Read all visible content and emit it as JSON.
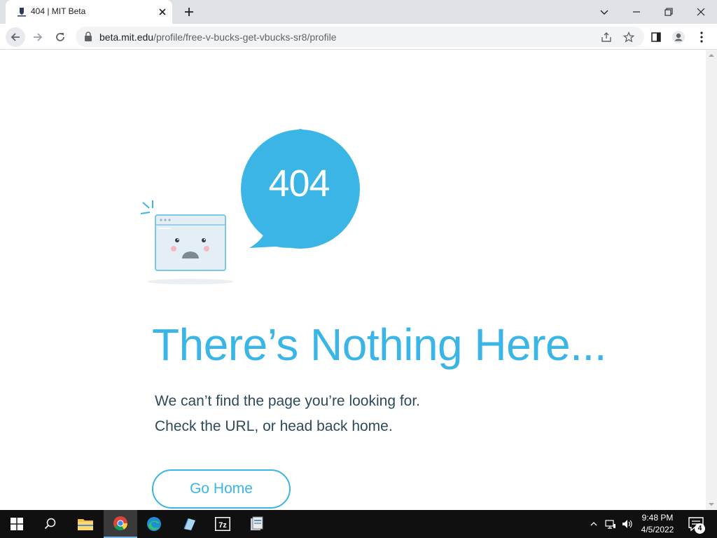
{
  "tab": {
    "title": "404 | MIT Beta",
    "favicon": "mit-shield-icon"
  },
  "toolbar": {
    "url_host": "beta.mit.edu",
    "url_path": "/profile/free-v-bucks-get-vbucks-sr8/profile"
  },
  "page": {
    "code": "404",
    "headline": "There’s Nothing Here...",
    "line1": "We can’t find the page you’re looking for.",
    "line2": "Check the URL, or head back home.",
    "button_label": "Go Home",
    "accent_color": "#3ab5e6"
  },
  "taskbar": {
    "apps": [
      "start",
      "search",
      "file-explorer",
      "chrome",
      "edge",
      "notepad",
      "7zip",
      "app"
    ],
    "time": "9:48 PM",
    "date": "4/5/2022",
    "notification_count": "4"
  }
}
